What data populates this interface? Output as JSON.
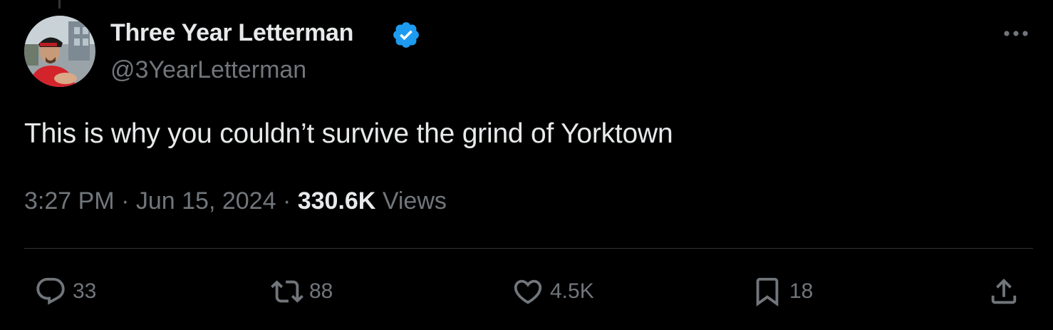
{
  "tweet": {
    "author": {
      "name": "Three Year Letterman",
      "handle": "@3YearLetterman",
      "verified": true
    },
    "text": "This is why you couldn’t survive the grind of Yorktown",
    "meta": {
      "time": "3:27 PM",
      "separator": "·",
      "date": "Jun 15, 2024",
      "views_count": "330.6K",
      "views_label": "Views"
    },
    "stats": {
      "replies": "33",
      "reposts": "88",
      "likes": "4.5K",
      "bookmarks": "18"
    }
  },
  "colors": {
    "background": "#000000",
    "primary_text": "#e7e9ea",
    "secondary_text": "#71767b",
    "divider": "#2f3336",
    "verified_badge": "#1d9bf0"
  },
  "icons": {
    "more": "more-horizontal-icon",
    "reply": "reply-bubble-icon",
    "repost": "repost-arrows-icon",
    "like": "heart-icon",
    "bookmark": "bookmark-icon",
    "share": "share-upload-icon",
    "verified": "verified-badge-icon"
  }
}
